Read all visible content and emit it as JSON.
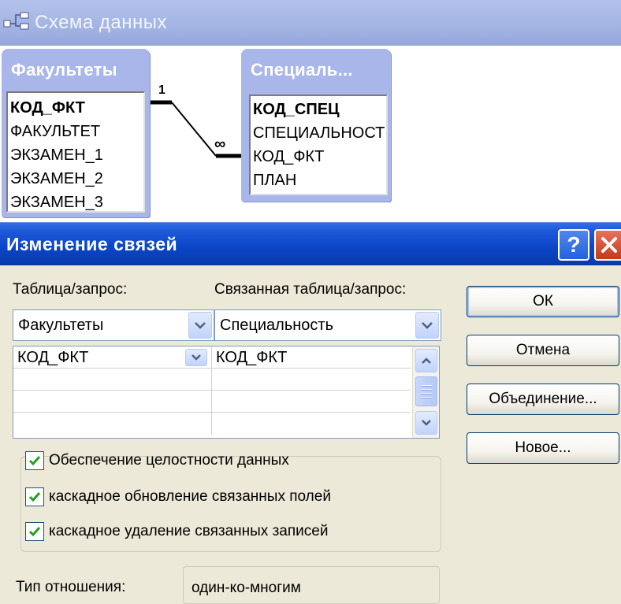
{
  "schema_window": {
    "title": "Схема данных",
    "tables": [
      {
        "title": "Факультеты",
        "primary_key": "КОД_ФКТ",
        "fields": [
          "ФАКУЛЬТЕТ",
          "ЭКЗАМЕН_1",
          "ЭКЗАМЕН_2",
          "ЭКЗАМЕН_3"
        ]
      },
      {
        "title": "Специаль...",
        "primary_key": "КОД_СПЕЦ",
        "fields": [
          "СПЕЦИАЛЬНОСТ",
          "КОД_ФКТ",
          "ПЛАН"
        ]
      }
    ],
    "relationship": {
      "one_label": "1",
      "many_label": "∞"
    }
  },
  "dialog": {
    "title": "Изменение связей",
    "help_label": "?",
    "table_label": "Таблица/запрос:",
    "related_table_label": "Связанная таблица/запрос:",
    "table_value": "Факультеты",
    "related_table_value": "Специальность",
    "field_rows": [
      {
        "left": "КОД_ФКТ",
        "right": "КОД_ФКТ"
      },
      {
        "left": "",
        "right": ""
      },
      {
        "left": "",
        "right": ""
      },
      {
        "left": "",
        "right": ""
      }
    ],
    "checkboxes": [
      {
        "label": "Обеспечение целостности данных",
        "checked": true
      },
      {
        "label": "каскадное обновление связанных полей",
        "checked": true
      },
      {
        "label": "каскадное удаление связанных записей",
        "checked": true
      }
    ],
    "buttons": {
      "ok": "ОК",
      "cancel": "Отмена",
      "join": "Объединение...",
      "new": "Новое..."
    },
    "relation_type_label": "Тип отношения:",
    "relation_type_value": "один-ко-многим"
  },
  "colors": {
    "xp_title_blue": "#0b47c9",
    "schema_title": "#a4b5e4",
    "table_header": "#a8b6ea",
    "close_red": "#c23a1c",
    "dialog_bg": "#ece9d8",
    "check_green": "#21a121"
  }
}
